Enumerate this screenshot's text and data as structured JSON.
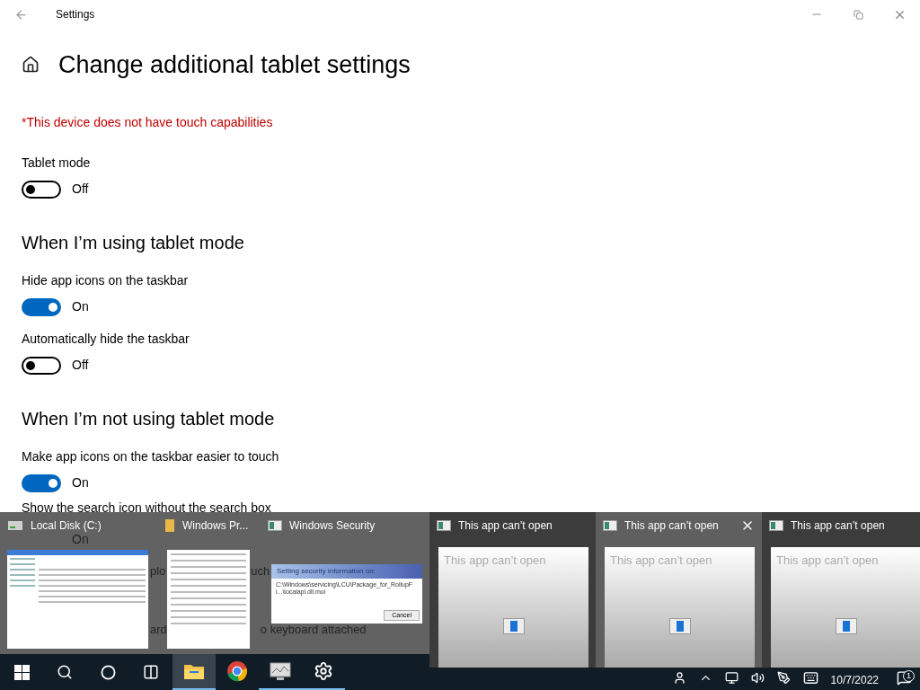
{
  "window": {
    "title": "Settings"
  },
  "page": {
    "title": "Change additional tablet settings",
    "notice": "*This device does not have touch capabilities"
  },
  "items": [
    {
      "kind": "toggle",
      "label": "Tablet mode",
      "on": false,
      "state_text": "Off"
    },
    {
      "kind": "heading",
      "text": "When I’m using tablet mode"
    },
    {
      "kind": "toggle",
      "label": "Hide app icons on the taskbar",
      "on": true,
      "state_text": "On"
    },
    {
      "kind": "toggle",
      "label": "Automatically hide the taskbar",
      "on": false,
      "state_text": "Off"
    },
    {
      "kind": "heading",
      "text": "When I’m not using tablet mode"
    },
    {
      "kind": "toggle",
      "label": "Make app icons on the taskbar easier to touch",
      "on": true,
      "state_text": "On"
    },
    {
      "kind": "label_state",
      "label": "Show the search icon without the search box",
      "state_text": "On"
    },
    {
      "kind": "fragments",
      "parts": [
        "plo",
        "uch"
      ]
    },
    {
      "kind": "fragments",
      "parts": [
        "ard",
        "o keyboard attached"
      ]
    }
  ],
  "switcher": [
    {
      "kind": "explorer",
      "title": "Local Disk (C:)",
      "selected": false
    },
    {
      "kind": "properties",
      "title": "Windows Pr...",
      "selected": false
    },
    {
      "kind": "security",
      "title": "Windows Security",
      "selected": false,
      "dialog_title": "Setting security information on:",
      "dialog_path": "C:\\Windows\\servicing\\LCU\\Package_for_RollupFi...\\localapl.dll.mui",
      "button": "Cancel"
    },
    {
      "kind": "app",
      "title": "This app can’t open",
      "selected": false,
      "preview_text": "This app can’t open"
    },
    {
      "kind": "app",
      "title": "This app can’t open",
      "selected": true,
      "preview_text": "This app can’t open"
    },
    {
      "kind": "app",
      "title": "This app can’t open",
      "selected": false,
      "preview_text": "This app can’t open"
    }
  ],
  "taskbar": {
    "apps": [
      {
        "kind": "explorer",
        "open": true,
        "selected": true
      },
      {
        "kind": "chrome",
        "open": false,
        "selected": false
      },
      {
        "kind": "monitor",
        "open": true,
        "selected": false
      },
      {
        "kind": "settings",
        "open": true,
        "selected": false
      }
    ],
    "date": "10/7/2022",
    "notifications": "1"
  }
}
